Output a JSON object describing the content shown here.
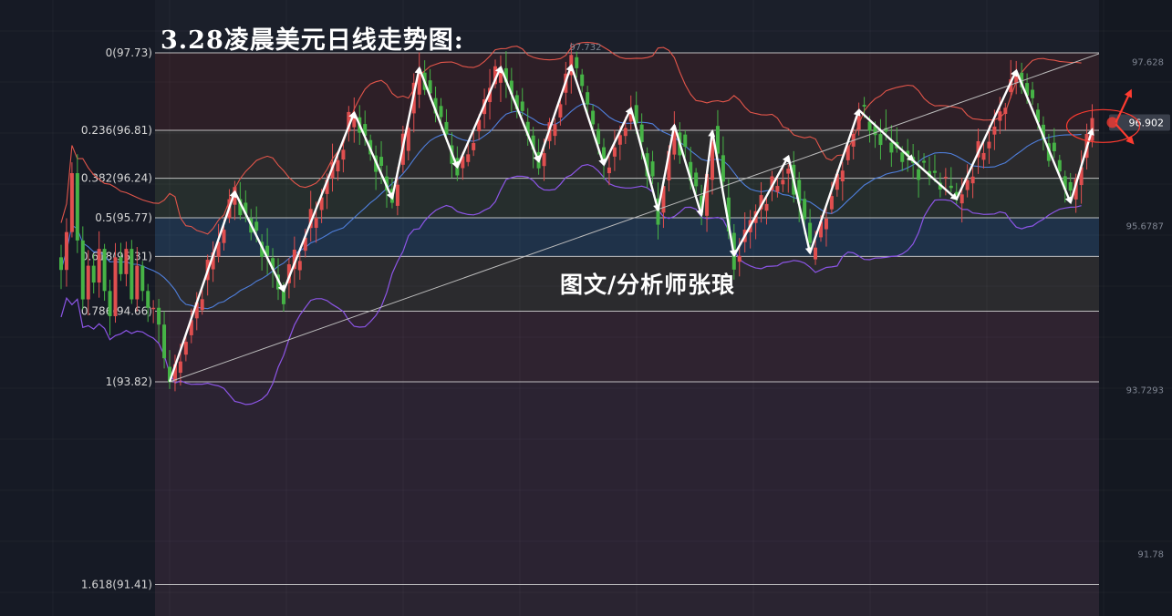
{
  "title": "3.28凌晨美元日线走势图:",
  "author": "图文/分析师张琅",
  "chart_data": {
    "type": "candlestick",
    "title": "3.28凌晨美元日线走势图:",
    "fib_levels": [
      {
        "label": "0(97.73)",
        "ratio": 0,
        "price": 97.73
      },
      {
        "label": "0.236(96.81)",
        "ratio": 0.236,
        "price": 96.81
      },
      {
        "label": "0.382(96.24)",
        "ratio": 0.382,
        "price": 96.24
      },
      {
        "label": "0.5(95.77)",
        "ratio": 0.5,
        "price": 95.77
      },
      {
        "label": "0.618(95.31)",
        "ratio": 0.618,
        "price": 95.31
      },
      {
        "label": "0.786(94.66)",
        "ratio": 0.786,
        "price": 94.66
      },
      {
        "label": "1(93.82)",
        "ratio": 1,
        "price": 93.82
      },
      {
        "label": "1.618(91.41)",
        "ratio": 1.618,
        "price": 91.41
      }
    ],
    "y_ticks": [
      "97.628",
      "95.6787",
      "93.7293",
      "91.78"
    ],
    "high_marker": "97.732",
    "current_price": "96.902",
    "ylim": [
      91.3,
      97.95
    ],
    "colors": {
      "up": "#e04f4f",
      "down": "#46b346",
      "upper_band": "#e2554a",
      "middle_band": "#4f7fdc",
      "lower_band": "#8c55e6",
      "trendline": "#bdbdbd",
      "arrow": "#ffffff",
      "signal": "#ff3b30"
    },
    "zigzag": [
      93.82,
      95.2,
      94.4,
      96.15,
      95.1,
      96.69,
      95.2,
      96.8,
      95.35,
      96.33,
      95.7,
      95.68,
      95.6,
      96.35,
      96.6,
      95.9,
      95.6,
      96.0,
      95.8,
      95.95,
      95.78,
      96.3,
      95.85,
      96.19,
      95.93,
      96.02,
      96.25,
      96.0,
      95.98,
      96.06
    ],
    "zigzag_points": [
      {
        "bar": 0,
        "price": 93.82
      },
      {
        "bar": 12,
        "price": 96.08
      },
      {
        "bar": 21,
        "price": 94.9
      },
      {
        "bar": 34,
        "price": 97.02
      },
      {
        "bar": 41,
        "price": 96.0
      },
      {
        "bar": 46,
        "price": 97.55
      },
      {
        "bar": 53,
        "price": 96.37
      },
      {
        "bar": 61,
        "price": 97.56
      },
      {
        "bar": 68,
        "price": 96.44
      },
      {
        "bar": 74,
        "price": 97.58
      },
      {
        "bar": 80,
        "price": 96.4
      },
      {
        "bar": 85,
        "price": 97.07
      },
      {
        "bar": 90,
        "price": 95.86
      },
      {
        "bar": 93,
        "price": 96.87
      },
      {
        "bar": 98,
        "price": 95.8
      },
      {
        "bar": 100,
        "price": 96.8
      },
      {
        "bar": 104,
        "price": 95.32
      },
      {
        "bar": 114,
        "price": 96.5
      },
      {
        "bar": 118,
        "price": 95.35
      },
      {
        "bar": 127,
        "price": 97.05
      },
      {
        "bar": 137,
        "price": 96.45
      },
      {
        "bar": 145,
        "price": 95.99
      },
      {
        "bar": 156,
        "price": 97.52
      },
      {
        "bar": 166,
        "price": 95.95
      },
      {
        "bar": 170,
        "price": 96.82
      }
    ]
  }
}
